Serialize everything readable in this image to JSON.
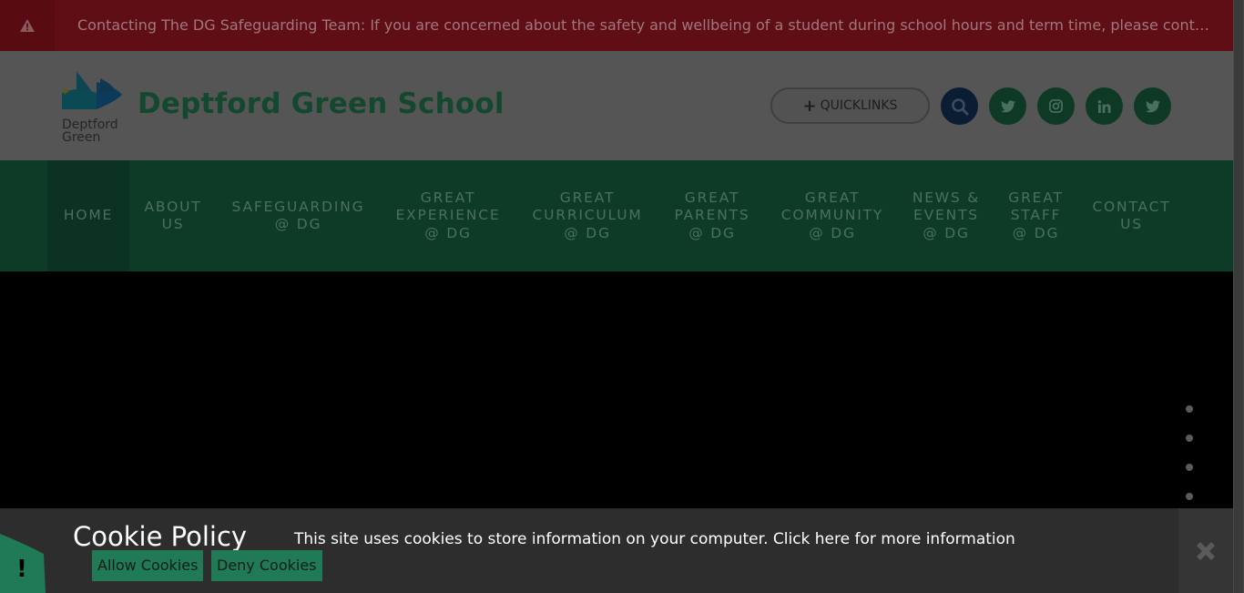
{
  "alert": {
    "icon": "warning-icon",
    "text": "Contacting The DG Safeguarding Team: If you are concerned about the safety and wellbeing of a student during school hours and term time, please contact the safeguarding team"
  },
  "header": {
    "logo_line1": "Deptford",
    "logo_line2": "Green",
    "school_name": "Deptford Green School",
    "quicklinks_plus": "+",
    "quicklinks_label": "QUICKLINKS",
    "icons": [
      "search-icon",
      "twitter-icon",
      "instagram-icon",
      "linkedin-icon",
      "twitter-icon"
    ]
  },
  "nav": {
    "items": [
      {
        "label": "HOME"
      },
      {
        "label": "ABOUT US"
      },
      {
        "label": "SAFEGUARDING @ DG"
      },
      {
        "label": "GREAT EXPERIENCE @ DG"
      },
      {
        "label": "GREAT CURRICULUM @ DG"
      },
      {
        "label": "GREAT PARENTS @ DG"
      },
      {
        "label": "GREAT COMMUNITY @ DG"
      },
      {
        "label": "NEWS & EVENTS @ DG"
      },
      {
        "label": "GREAT STAFF @ DG"
      },
      {
        "label": "CONTACT US"
      }
    ]
  },
  "hero": {
    "slide_dots": 4
  },
  "cookie": {
    "title": "Cookie Policy",
    "message": "This site uses cookies to store information on your computer. Click here for more information",
    "allow_label": "Allow Cookies",
    "deny_label": "Deny Cookies"
  },
  "alert_tab": {
    "glyph": "!"
  },
  "colors": {
    "alert_bg": "#5e0e14",
    "header_bg": "#555555",
    "brand_green": "#13482f",
    "nav_bg": "#0e3b28",
    "cookie_bg": "#2d2d2d",
    "cookie_button": "#1f7a55",
    "tab_green": "#1f7a55"
  }
}
